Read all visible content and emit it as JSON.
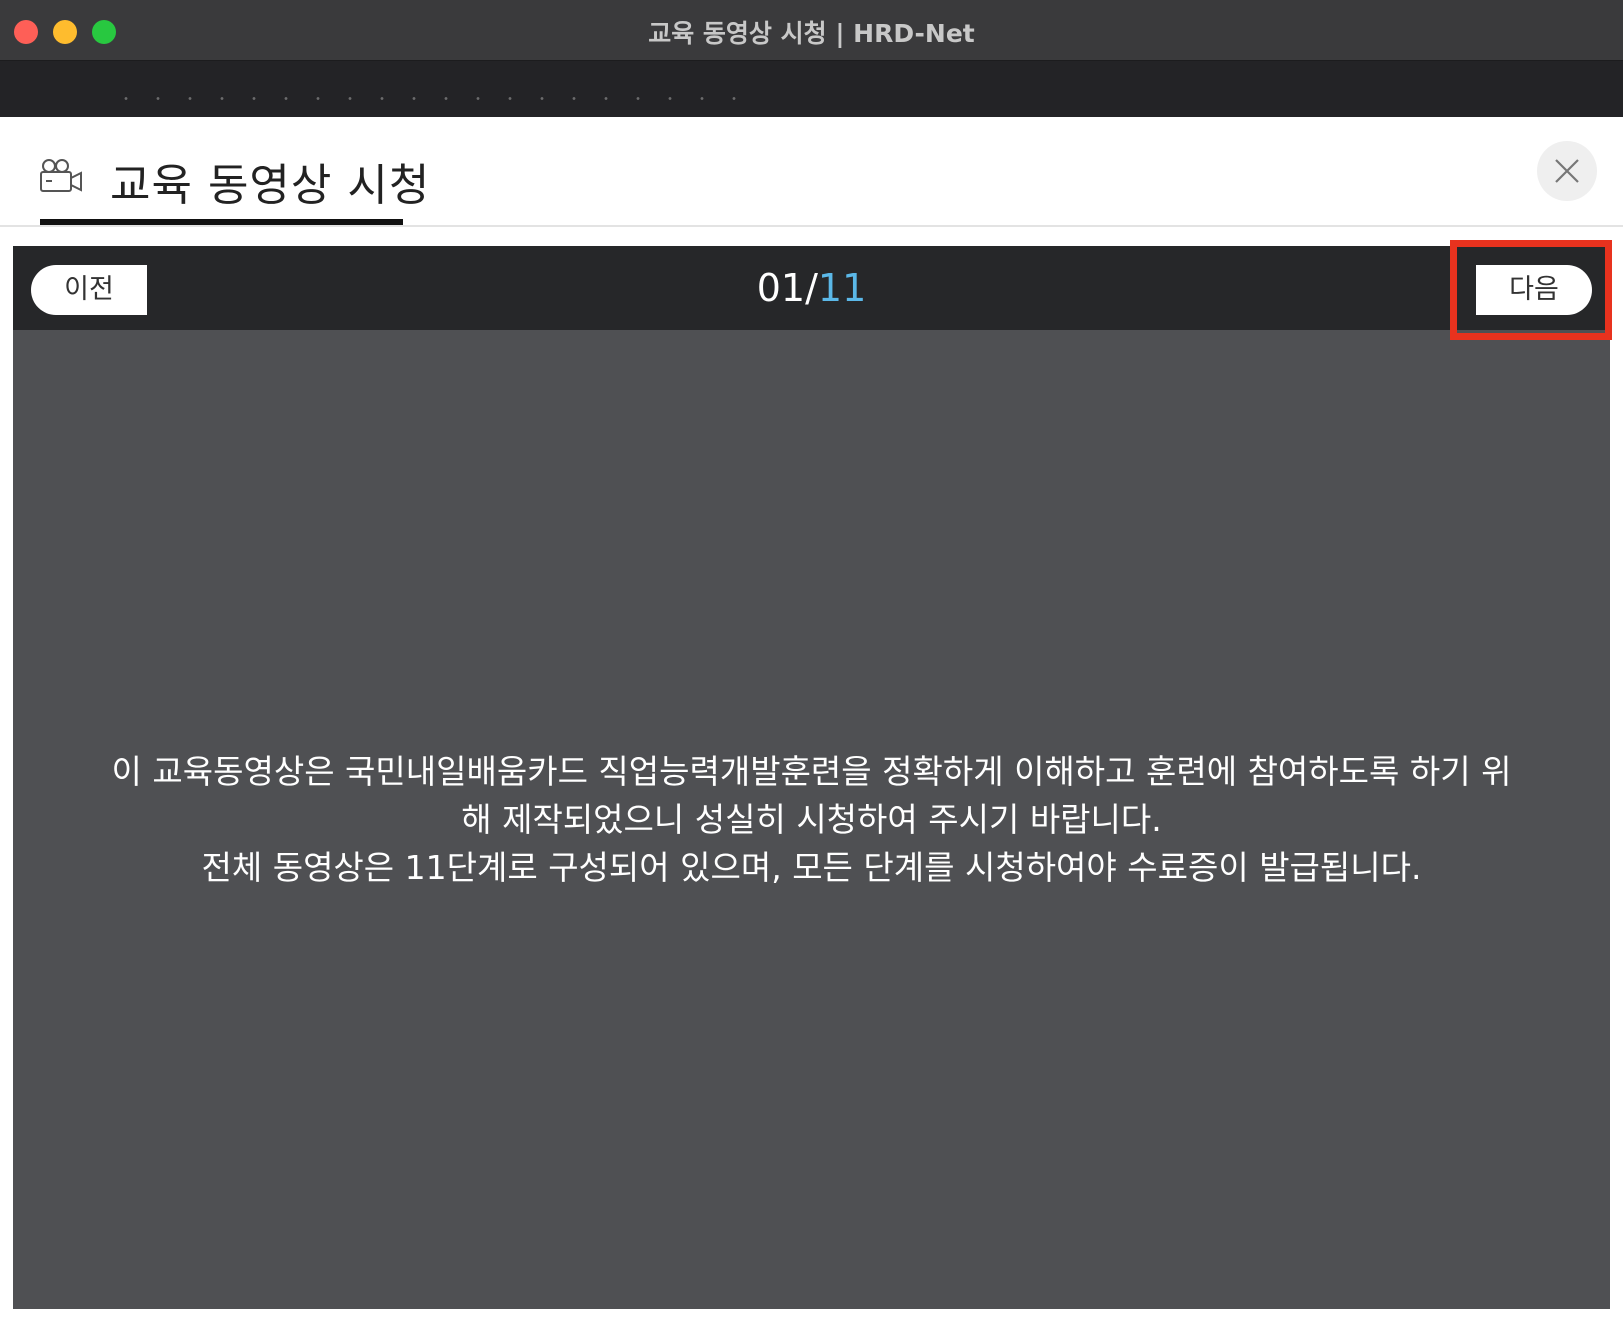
{
  "window": {
    "title": "교육 동영상 시청 | HRD-Net"
  },
  "header": {
    "title": "교육 동영상 시청",
    "icon": "video-camera-icon"
  },
  "player": {
    "prev_label": "이전",
    "next_label": "다음",
    "current_page": "01",
    "separator": "/",
    "total_pages": "11",
    "intro_lines": [
      "이 교육동영상은 국민내일배움카드 직업능력개발훈련을 정확하게 이해하고 훈련에 참여하도록 하기 위",
      "해 제작되었으니 성실히 시청하여 주시기 바랍니다.",
      "전체 동영상은 11단계로 구성되어 있으며, 모든 단계를 시청하여야 수료증이 발급됩니다."
    ]
  },
  "colors": {
    "highlight": "#e8321e",
    "total_pages_accent": "#5bb8e8",
    "player_background": "#4f5053",
    "nav_background": "#262729"
  }
}
